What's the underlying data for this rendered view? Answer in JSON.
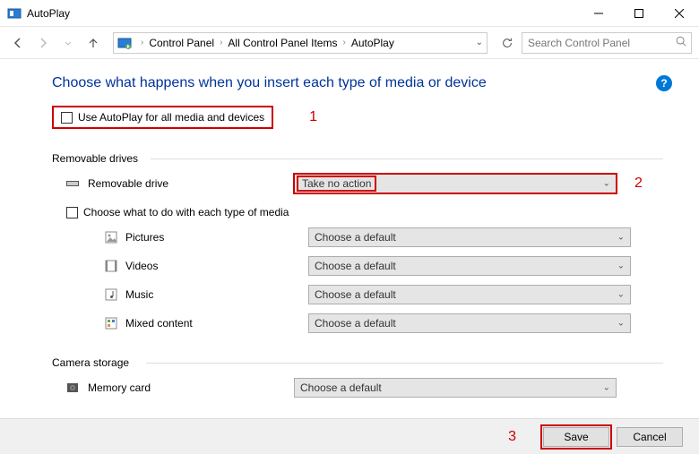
{
  "window": {
    "title": "AutoPlay"
  },
  "breadcrumbs": {
    "b0": "Control Panel",
    "b1": "All Control Panel Items",
    "b2": "AutoPlay"
  },
  "search": {
    "placeholder": "Search Control Panel"
  },
  "heading": "Choose what happens when you insert each type of media or device",
  "useAll": {
    "label": "Use AutoPlay for all media and devices"
  },
  "annotations": {
    "a1": "1",
    "a2": "2",
    "a3": "3"
  },
  "sections": {
    "removable": "Removable drives",
    "camera": "Camera storage"
  },
  "removableDrive": {
    "label": "Removable drive",
    "value": "Take no action"
  },
  "mediaTypesChk": "Choose what to do with each type of media",
  "media": {
    "pictures": {
      "label": "Pictures",
      "value": "Choose a default"
    },
    "videos": {
      "label": "Videos",
      "value": "Choose a default"
    },
    "music": {
      "label": "Music",
      "value": "Choose a default"
    },
    "mixed": {
      "label": "Mixed content",
      "value": "Choose a default"
    }
  },
  "memoryCard": {
    "label": "Memory card",
    "value": "Choose a default"
  },
  "buttons": {
    "save": "Save",
    "cancel": "Cancel"
  },
  "help": "?"
}
